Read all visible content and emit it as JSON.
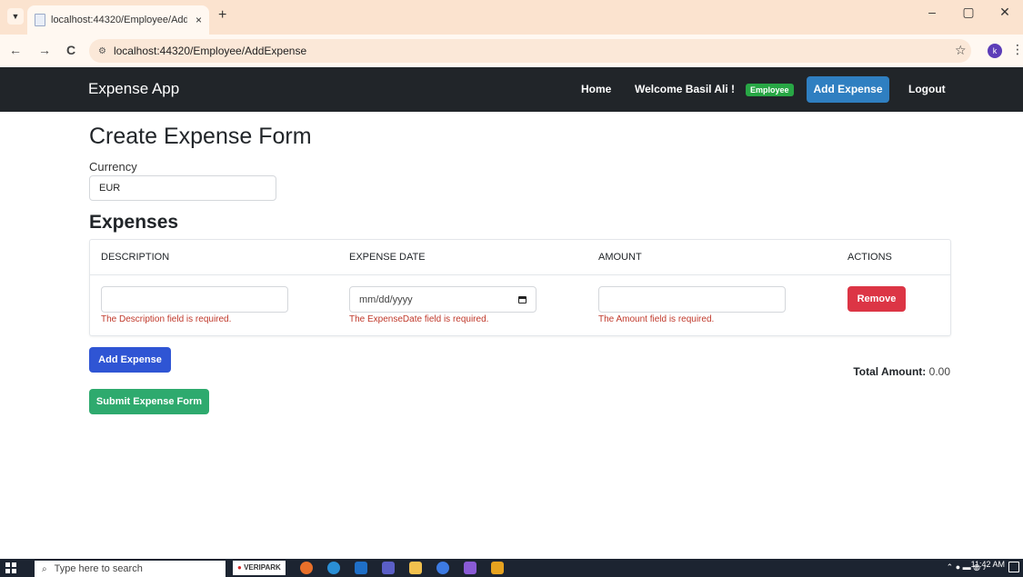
{
  "browser": {
    "tab_title": "localhost:44320/Employee/Add",
    "tab_close": "×",
    "new_tab": "+",
    "url": "localhost:44320/Employee/AddExpense",
    "profile_initial": "k",
    "window_controls": {
      "minimize": "–",
      "maximize": "▢",
      "close": "✕"
    },
    "nav": {
      "back": "←",
      "forward": "→",
      "reload": "C"
    }
  },
  "navbar": {
    "brand": "Expense App",
    "home": "Home",
    "welcome": "Welcome Basil Ali !",
    "role_badge": "Employee",
    "add_expense": "Add Expense",
    "logout": "Logout"
  },
  "form": {
    "title": "Create Expense Form",
    "currency_label": "Currency",
    "currency_value": "EUR",
    "expenses_title": "Expenses",
    "columns": [
      "DESCRIPTION",
      "EXPENSE DATE",
      "AMOUNT",
      "ACTIONS"
    ],
    "row": {
      "description_value": "",
      "date_placeholder": "mm/dd/yyyy",
      "amount_value": "",
      "remove_label": "Remove",
      "errors": {
        "description": "The Description field is required.",
        "date": "The ExpenseDate field is required.",
        "amount": "The Amount field is required."
      }
    },
    "add_expense_label": "Add Expense",
    "total_label": "Total Amount:",
    "total_value": "0.00",
    "submit_label": "Submit Expense Form"
  },
  "taskbar": {
    "search_placeholder": "Type here to search",
    "veripark_label": "VERIPARK",
    "time": "11:42 AM"
  },
  "colors": {
    "navbar_bg": "#212529",
    "primary": "#2f55d4",
    "danger": "#dc3545",
    "success": "#2eaa6e",
    "error_text": "#c0392b"
  }
}
